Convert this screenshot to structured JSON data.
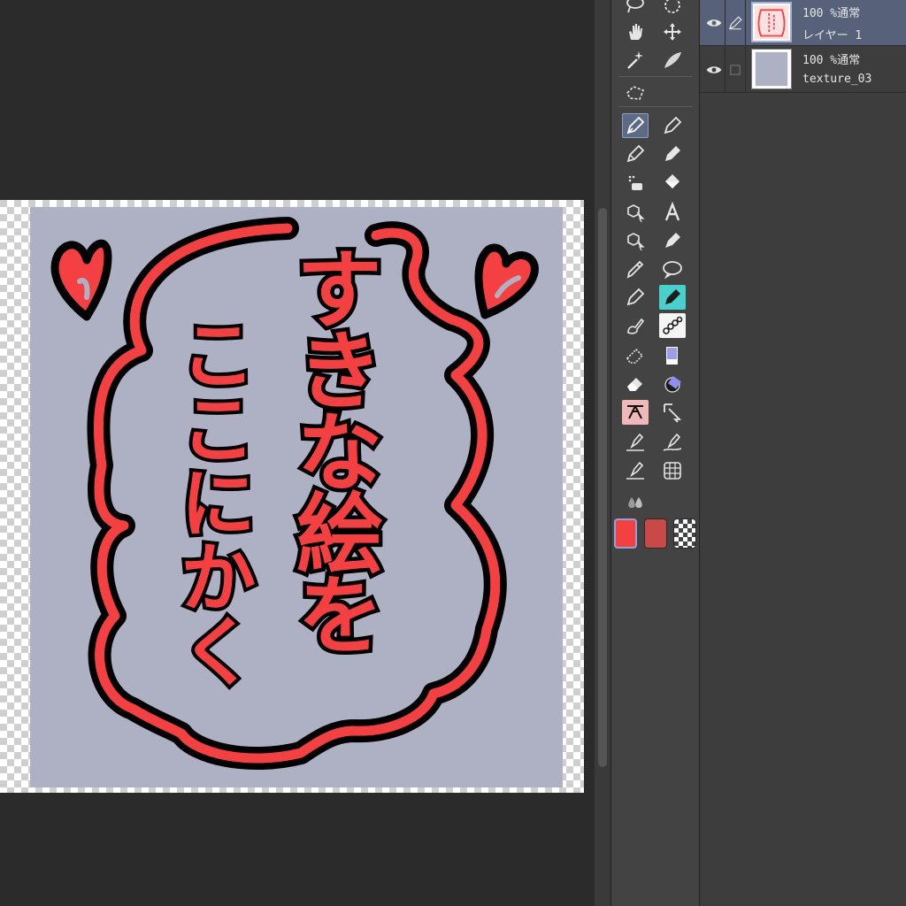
{
  "canvas": {
    "text_lines": [
      "すきな絵を",
      "ここにかく"
    ],
    "paper_color": "#adb1c3",
    "accent_red": "#f44040",
    "outline_color": "#000000"
  },
  "tools": [
    {
      "id": "lasso-icon"
    },
    {
      "id": "selection-icon"
    },
    {
      "id": "hand-icon"
    },
    {
      "id": "move-icon"
    },
    {
      "id": "magic-wand-icon"
    },
    {
      "id": "brush-stroke-icon"
    },
    {
      "id": "selection-pen-icon"
    },
    {
      "id": "pen-icon",
      "active": true
    },
    {
      "id": "marker-icon"
    },
    {
      "id": "pencil-icon"
    },
    {
      "id": "pencil-alt-icon"
    },
    {
      "id": "auto-fill-icon"
    },
    {
      "id": "fill-bucket-icon"
    },
    {
      "id": "object-select-icon"
    },
    {
      "id": "text-tool-icon"
    },
    {
      "id": "operation-icon"
    },
    {
      "id": "vector-pen-icon"
    },
    {
      "id": "eyedropper-icon"
    },
    {
      "id": "speech-balloon-icon"
    },
    {
      "id": "g-pen-icon"
    },
    {
      "id": "teal-pen-icon"
    },
    {
      "id": "blend-icon"
    },
    {
      "id": "chain-brush-icon"
    },
    {
      "id": "soft-eraser-icon"
    },
    {
      "id": "color-chip-icon"
    },
    {
      "id": "hard-eraser-icon"
    },
    {
      "id": "gradient-tool-icon"
    },
    {
      "id": "figure-decoration-icon"
    },
    {
      "id": "correction-icon"
    },
    {
      "id": "line-pen-icon"
    },
    {
      "id": "line-pen-alt-icon"
    },
    {
      "id": "smooth-pen-icon"
    },
    {
      "id": "ruler-grid-icon"
    },
    {
      "id": "blur-drops-icon"
    }
  ],
  "colors": {
    "main": "#f44040",
    "sub": "#c94848",
    "transparent_label": "transparent-color"
  },
  "layers": [
    {
      "opacity_blend": "100 %通常",
      "name": "レイヤー 1",
      "selected": true,
      "visible": true
    },
    {
      "opacity_blend": "100 %通常",
      "name": "texture_03",
      "selected": false,
      "visible": true
    }
  ]
}
